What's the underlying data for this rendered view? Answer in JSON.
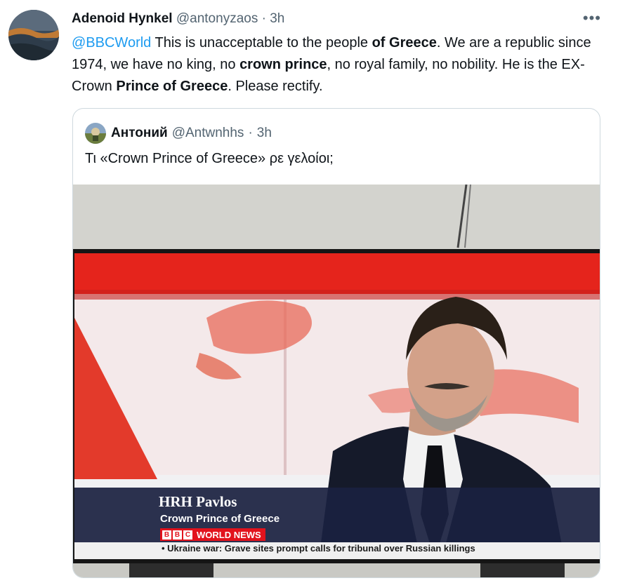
{
  "tweet": {
    "author_name": "Adenoid Hynkel",
    "author_handle": "@antonyzaos",
    "separator": "·",
    "time": "3h",
    "more_icon": "more-horizontal-icon",
    "text": {
      "mention": "@BBCWorld",
      "t1": " This is unacceptable to the people ",
      "b1": "of Greece",
      "t2": ". We are a republic since 1974, we have no king, no ",
      "b2": "crown prince",
      "t3": ", no royal family, no nobility. He is the EX-Crown ",
      "b3": "Prince of Greece",
      "t4": ". Please rectify."
    }
  },
  "quoted_tweet": {
    "author_name": "Антоний",
    "author_handle": "@Antwnhhs",
    "separator": "·",
    "time": "3h",
    "text": "Τι «Crown Prince of Greece» ρε γελοίοι;",
    "image": {
      "lower_third_name": "HRH Pavlos",
      "lower_third_title": "Crown Prince of Greece",
      "bbc_letters": [
        "B",
        "B",
        "C"
      ],
      "channel": "WORLD NEWS",
      "ticker": "• Ukraine war: Grave sites prompt calls for tribunal over Russian killings"
    }
  },
  "colors": {
    "link": "#1d9bf0",
    "secondary_text": "#536471",
    "border": "#cfd9de",
    "bbc_red": "#e2131d"
  }
}
